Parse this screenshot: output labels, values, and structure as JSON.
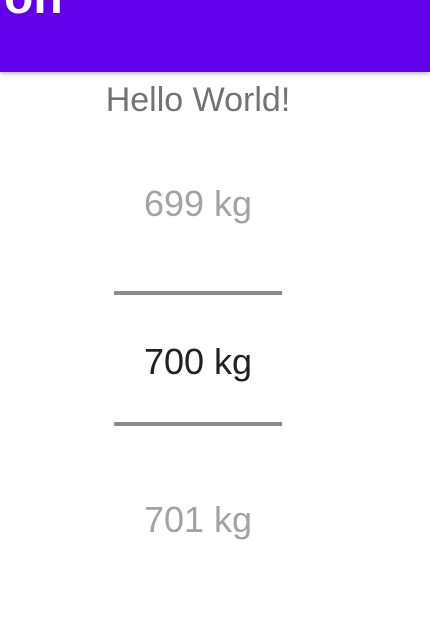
{
  "app_bar": {
    "title": "on",
    "color": "#6200ee"
  },
  "main": {
    "greeting": "Hello World!"
  },
  "number_picker": {
    "previous_value": "699 kg",
    "selected_value": "700 kg",
    "next_value": "701 kg"
  }
}
